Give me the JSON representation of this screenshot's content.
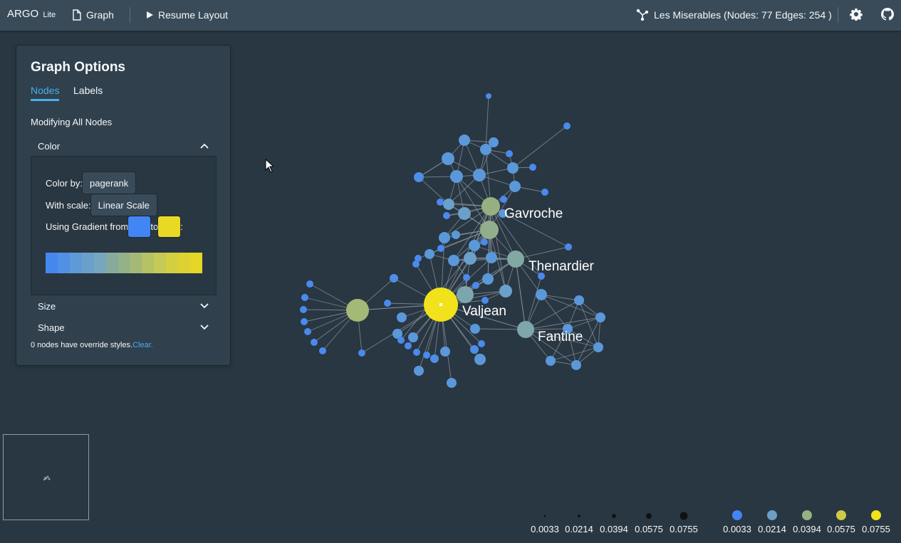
{
  "topbar": {
    "brand": "ARGO",
    "brand_suffix": "Lite",
    "graph_label": "Graph",
    "resume_label": "Resume Layout",
    "graph_info": "Les Miserables (Nodes: 77 Edges: 254 )"
  },
  "panel": {
    "title": "Graph Options",
    "tabs": [
      "Nodes",
      "Labels"
    ],
    "active_tab": "Nodes",
    "modifying": "Modifying All Nodes",
    "sections": {
      "color": "Color",
      "size": "Size",
      "shape": "Shape"
    },
    "color_by_label": "Color by:",
    "color_by_value": "pagerank",
    "scale_label": "With scale:",
    "scale_value": "Linear Scale",
    "gradient_from_label": "Using Gradient from",
    "gradient_to_label": "to",
    "gradient_colon": ":",
    "gradient_from_color": "#4285f4",
    "gradient_to_color": "#ead924",
    "gradient_steps": [
      "#4488ee",
      "#5091e6",
      "#5e9ad8",
      "#6aa0cc",
      "#78a6bf",
      "#86ab9d",
      "#94b187",
      "#a5b977",
      "#b6c266",
      "#c6c955",
      "#d4cf41",
      "#ddd232",
      "#e6d628"
    ],
    "override_text": "0 nodes have override styles.",
    "clear_label": "Clear."
  },
  "graph": {
    "labels": [
      {
        "text": "Gavroche"
      },
      {
        "text": "Thenardier"
      },
      {
        "text": "Valjean"
      },
      {
        "text": "Fantine"
      }
    ]
  },
  "legend": {
    "size": {
      "values": [
        "0.0033",
        "0.0214",
        "0.0394",
        "0.0575",
        "0.0755"
      ],
      "color": "#111111"
    },
    "color": {
      "values": [
        "0.0033",
        "0.0214",
        "0.0394",
        "0.0575",
        "0.0755"
      ],
      "colors": [
        "#4285f4",
        "#6c9fc8",
        "#96b080",
        "#d0ca45",
        "#f1e21c"
      ]
    }
  }
}
